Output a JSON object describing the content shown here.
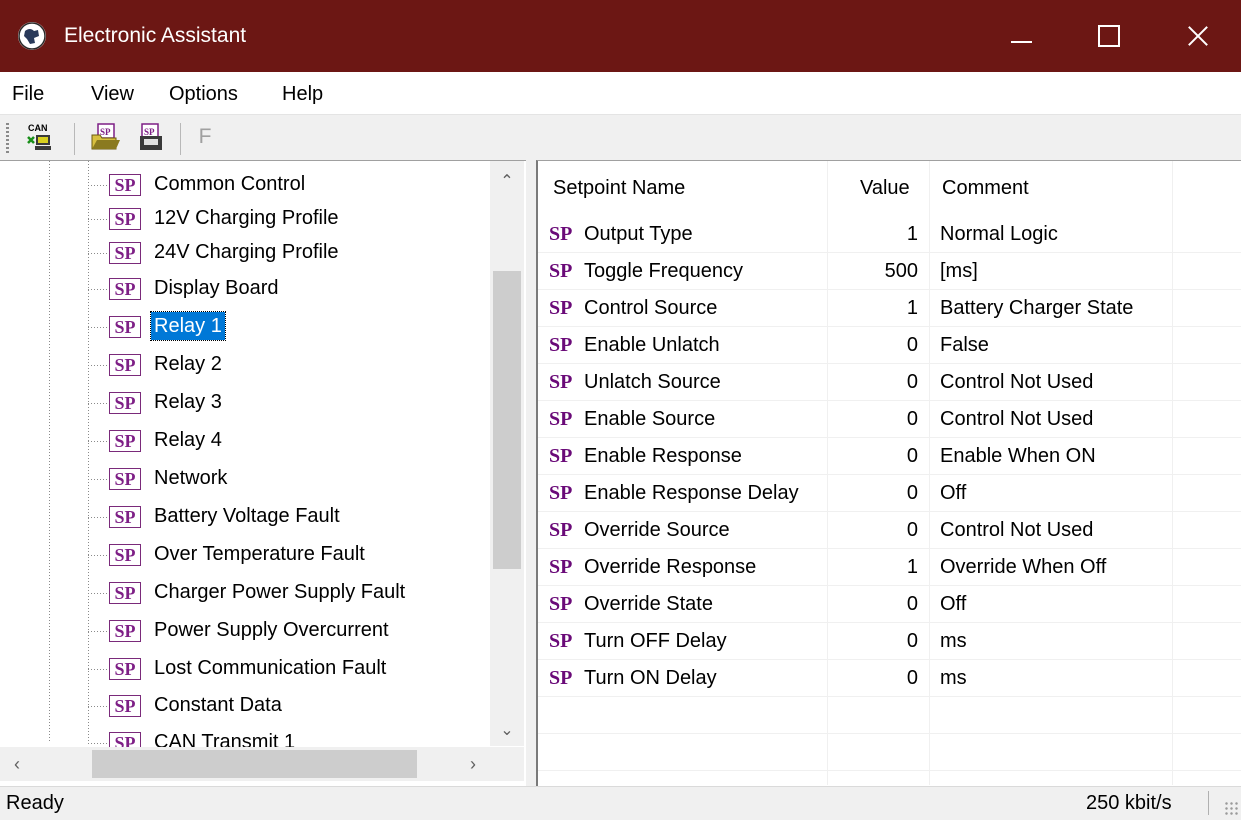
{
  "window": {
    "title": "Electronic Assistant"
  },
  "menu": [
    "File",
    "View",
    "Options",
    "Help"
  ],
  "toolbar": {
    "f_label": "F"
  },
  "tree": {
    "items": [
      "Common Control",
      "12V Charging Profile",
      "24V Charging Profile",
      "Display Board",
      "Relay 1",
      "Relay 2",
      "Relay 3",
      "Relay 4",
      "Network",
      "Battery Voltage Fault",
      "Over Temperature Fault",
      "Charger Power Supply Fault",
      "Power Supply Overcurrent",
      "Lost Communication Fault",
      "Constant Data",
      "CAN Transmit 1"
    ],
    "selected": "Relay 1",
    "icon_text": "SP"
  },
  "list": {
    "columns": {
      "name": "Setpoint Name",
      "value": "Value",
      "comment": "Comment"
    },
    "rows": [
      {
        "name": "Output Type",
        "value": "1",
        "comment": "Normal Logic"
      },
      {
        "name": "Toggle Frequency",
        "value": "500",
        "comment": "[ms]"
      },
      {
        "name": "Control Source",
        "value": "1",
        "comment": "Battery Charger State"
      },
      {
        "name": "Enable Unlatch",
        "value": "0",
        "comment": "False"
      },
      {
        "name": "Unlatch Source",
        "value": "0",
        "comment": "Control Not Used"
      },
      {
        "name": "Enable Source",
        "value": "0",
        "comment": "Control Not Used"
      },
      {
        "name": "Enable Response",
        "value": "0",
        "comment": "Enable When ON"
      },
      {
        "name": "Enable Response Delay",
        "value": "0",
        "comment": "Off"
      },
      {
        "name": "Override Source",
        "value": "0",
        "comment": "Control Not Used"
      },
      {
        "name": "Override Response",
        "value": "1",
        "comment": "Override When Off"
      },
      {
        "name": "Override State",
        "value": "0",
        "comment": "Off"
      },
      {
        "name": "Turn OFF Delay",
        "value": "0",
        "comment": "ms"
      },
      {
        "name": "Turn ON Delay",
        "value": "0",
        "comment": "ms"
      }
    ]
  },
  "status": {
    "left": "Ready",
    "right": "250 kbit/s"
  },
  "colors": {
    "titlebar": "#6c1714",
    "selection": "#0078d7",
    "sp_purple": "#7e1f86"
  }
}
